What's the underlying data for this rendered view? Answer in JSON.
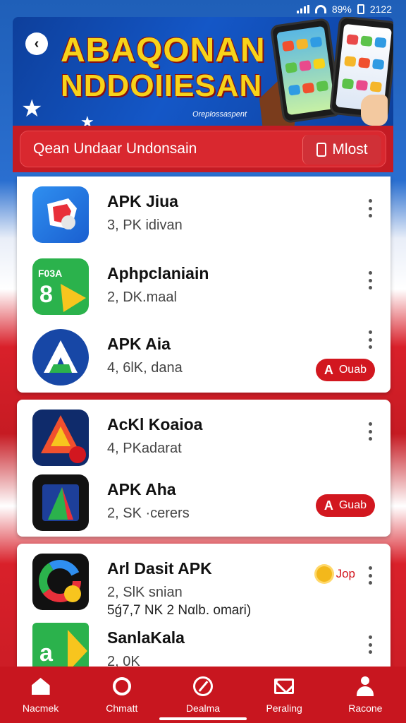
{
  "status_bar": {
    "battery": "89%",
    "time": "2122"
  },
  "banner": {
    "title_line1": "ABAQONAN",
    "title_line2": "NDDOIIESAN",
    "subtitle": "Oreplossaspent"
  },
  "search": {
    "text": "Qean Undaar Undonsain",
    "most_label": "Mlost"
  },
  "apps": [
    {
      "name": "APK Jiua",
      "meta": "3, PK idivan",
      "icon": "blue-shield-icon"
    },
    {
      "name": "Aphpclaniain",
      "meta": "2, DK.maal",
      "icon": "green-8-icon"
    },
    {
      "name": "APK Aia",
      "meta": "4, 6lK, dana",
      "icon": "blue-a-circle-icon",
      "action": "Ouab"
    },
    {
      "name": "AcKl Koaioa",
      "meta": "4, PKadarat",
      "icon": "red-a-icon"
    },
    {
      "name": "APK Aha",
      "meta": "2, SK ·cerers",
      "icon": "dark-a-icon",
      "action": "Guab"
    },
    {
      "name": "Arl Dasit APK",
      "meta": "2, SlK snian",
      "meta2": "5ǵ7,7 NK 2 Ναlb. omari)",
      "icon": "g-icon",
      "badge": "Jop"
    },
    {
      "name": "SanlaKala",
      "meta": "2, 0K",
      "icon": "green-a-icon"
    }
  ],
  "tabs": [
    {
      "label": "Nacmek",
      "icon": "home-icon"
    },
    {
      "label": "Chmatt",
      "icon": "chat-icon"
    },
    {
      "label": "Dealma",
      "icon": "compass-icon"
    },
    {
      "label": "Peraling",
      "icon": "mail-icon"
    },
    {
      "label": "Racone",
      "icon": "profile-icon"
    }
  ],
  "colors": {
    "accent": "#c8161f",
    "banner_blue": "#1457c7",
    "title_yellow": "#f7d31a"
  }
}
